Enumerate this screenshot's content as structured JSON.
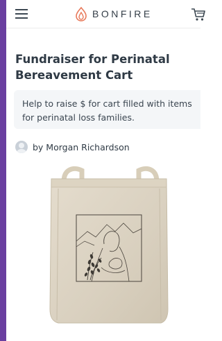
{
  "app": {
    "brand": "BONFIRE",
    "accent_color": "#6a3fa0",
    "logo_color": "#e8795a"
  },
  "header": {
    "menu_icon": "hamburger-icon",
    "cart_icon": "cart-icon"
  },
  "campaign": {
    "title": "Fundraiser for Perinatal Bereavement Cart",
    "description": "Help to raise $ for cart filled with items for perinatal loss families.",
    "byline": "by Morgan Richardson"
  },
  "product": {
    "image": "canvas-tote-bag-with-line-art"
  }
}
